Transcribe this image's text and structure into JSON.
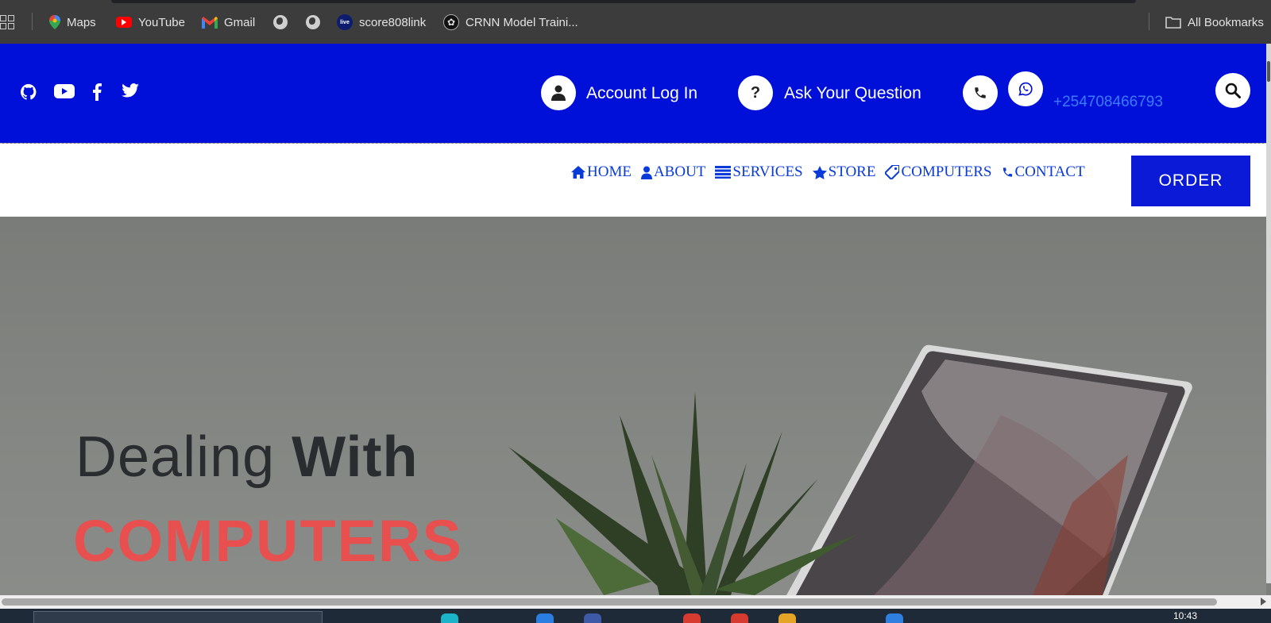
{
  "bookmarks": {
    "items": [
      {
        "label": "Maps",
        "icon": "maps-pin-icon"
      },
      {
        "label": "YouTube",
        "icon": "youtube-icon"
      },
      {
        "label": "Gmail",
        "icon": "gmail-icon"
      },
      {
        "label": "",
        "icon": "globe-icon"
      },
      {
        "label": "",
        "icon": "globe-icon"
      },
      {
        "label": "score808link",
        "icon": "live-icon"
      },
      {
        "label": "CRNN Model Traini...",
        "icon": "chatgpt-icon"
      }
    ],
    "live_badge": "live",
    "all_bookmarks": "All Bookmarks"
  },
  "header": {
    "social_icons": [
      "github-icon",
      "youtube-icon",
      "facebook-icon",
      "twitter-icon"
    ],
    "account_label": "Account Log In",
    "question_label": "Ask Your Question",
    "phone": "+254708466793",
    "colors": {
      "header_bg": "#0010d9",
      "phone_text": "#3b7cff"
    }
  },
  "nav": {
    "items": [
      {
        "label": "HOME",
        "icon": "home-icon"
      },
      {
        "label": "ABOUT",
        "icon": "user-icon"
      },
      {
        "label": "SERVICES",
        "icon": "server-icon"
      },
      {
        "label": "STORE",
        "icon": "star-icon"
      },
      {
        "label": "COMPUTERS",
        "icon": "tag-icon"
      },
      {
        "label": "CONTACT",
        "icon": "phone-icon"
      }
    ],
    "order_label": "ORDER"
  },
  "hero": {
    "line1_light": "Dealing ",
    "line1_bold": "With",
    "line2": "COMPUTERS",
    "colors": {
      "line1": "#2a2d30",
      "line2": "#e85050"
    }
  },
  "taskbar": {
    "clock": "10:43"
  }
}
